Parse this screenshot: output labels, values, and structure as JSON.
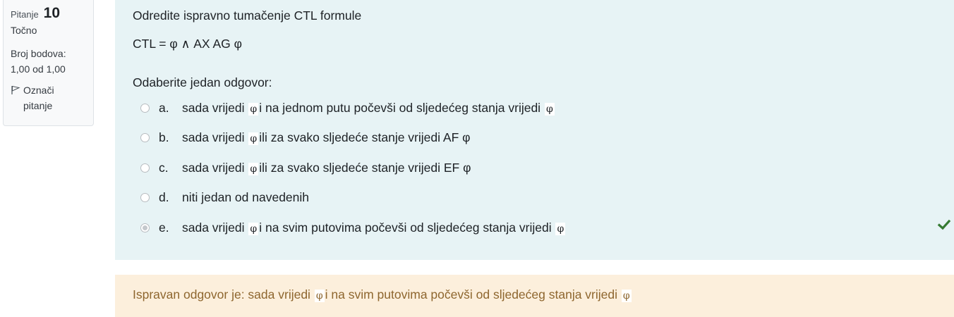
{
  "info": {
    "question_label": "Pitanje",
    "question_number": "10",
    "state": "Točno",
    "grade_line1": "Broj bodova:",
    "grade_line2": "1,00 od 1,00",
    "flag_line1": "Označi",
    "flag_line2": "pitanje"
  },
  "question": {
    "text": "Odredite ispravno tumačenje CTL formule",
    "formula": "CTL  = φ ∧ AX AG φ",
    "prompt": "Odaberite jedan odgovor:"
  },
  "answers": [
    {
      "letter": "a.",
      "pre": "sada vrijedi",
      "sym1": "φ",
      "mid": "i na jednom putu počevši od sljedećeg stanja vrijedi",
      "sym2": "φ"
    },
    {
      "letter": "b.",
      "pre": "sada vrijedi",
      "sym1": "φ",
      "mid": "ili za svako sljedeće stanje vrijedi AF φ"
    },
    {
      "letter": "c.",
      "pre": "sada vrijedi",
      "sym1": "φ",
      "mid": "ili za svako sljedeće stanje vrijedi EF φ"
    },
    {
      "letter": "d.",
      "pre": "niti jedan od navedenih"
    },
    {
      "letter": "e.",
      "pre": "sada vrijedi",
      "sym1": "φ",
      "mid": "i na svim putovima počevši od sljedećeg stanja vrijedi",
      "sym2": "φ",
      "selected": true,
      "correct": true
    }
  ],
  "feedback": {
    "pre": "Ispravan odgovor je: sada vrijedi",
    "sym1": "φ",
    "mid": "i na svim putovima počevši od sljedećeg stanja vrijedi",
    "sym2": "φ"
  },
  "colors": {
    "formulation_bg": "#e7f3f5",
    "feedback_bg": "#fcefdc",
    "feedback_text": "#8e662e",
    "correct_green": "#357a32"
  },
  "icons": {
    "flag": "flag-icon",
    "correct": "check-icon"
  }
}
